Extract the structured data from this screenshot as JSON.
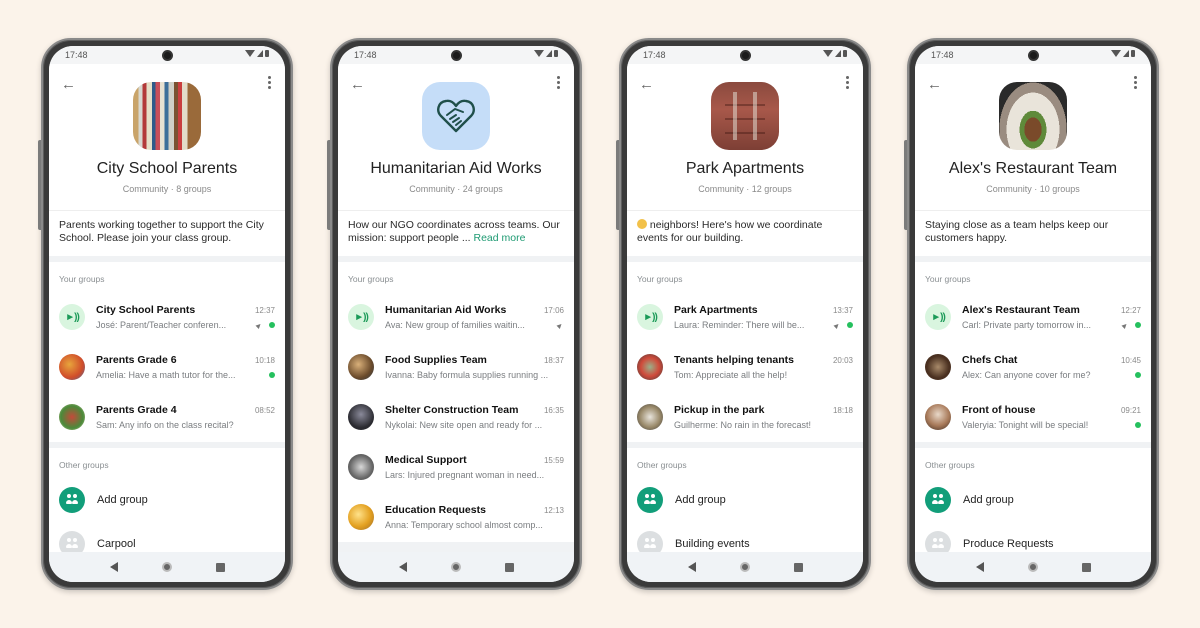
{
  "status_time": "17:48",
  "labels": {
    "your_groups": "Your groups",
    "other_groups": "Other groups",
    "add_group": "Add group"
  },
  "phones": [
    {
      "title": "City School Parents",
      "subtitle": "Community · 8 groups",
      "description": "Parents working together to support the City School. Please join your class group.",
      "read_more": "",
      "groups": [
        {
          "name": "City School Parents",
          "time": "12:37",
          "message": "José: Parent/Teacher conferen...",
          "pinned": true,
          "unread": true,
          "announcement": true
        },
        {
          "name": "Parents Grade 6",
          "time": "10:18",
          "message": "Amelia: Have a math tutor for the...",
          "pinned": false,
          "unread": true
        },
        {
          "name": "Parents Grade 4",
          "time": "08:52",
          "message": "Sam: Any info on the class recital?",
          "pinned": false,
          "unread": false
        }
      ],
      "other_groups": [
        "Carpool"
      ]
    },
    {
      "title": "Humanitarian Aid Works",
      "subtitle": "Community · 24 groups",
      "description": "How our NGO coordinates across teams. Our mission: support people ...",
      "read_more": "Read more",
      "groups": [
        {
          "name": "Humanitarian Aid Works",
          "time": "17:06",
          "message": "Ava: New group of families waitin...",
          "pinned": true,
          "unread": false,
          "announcement": true
        },
        {
          "name": "Food Supplies Team",
          "time": "18:37",
          "message": "Ivanna: Baby formula supplies running ...",
          "pinned": false,
          "unread": false
        },
        {
          "name": "Shelter Construction Team",
          "time": "16:35",
          "message": "Nykolai: New site open and ready for ...",
          "pinned": false,
          "unread": false
        },
        {
          "name": "Medical Support",
          "time": "15:59",
          "message": "Lars: Injured pregnant woman in need...",
          "pinned": false,
          "unread": false
        },
        {
          "name": "Education Requests",
          "time": "12:13",
          "message": "Anna: Temporary school almost comp...",
          "pinned": false,
          "unread": false
        }
      ],
      "other_groups": []
    },
    {
      "title": "Park Apartments",
      "subtitle": "Community · 12 groups",
      "description": "neighbors! Here's how we coordinate events for our building.",
      "read_more": "",
      "groups": [
        {
          "name": "Park Apartments",
          "time": "13:37",
          "message": "Laura: Reminder: There will be...",
          "pinned": true,
          "unread": true,
          "announcement": true
        },
        {
          "name": "Tenants helping tenants",
          "time": "20:03",
          "message": "Tom: Appreciate all the help!",
          "pinned": false,
          "unread": false
        },
        {
          "name": "Pickup in the park",
          "time": "18:18",
          "message": "Guilherme: No rain in the forecast!",
          "pinned": false,
          "unread": false
        }
      ],
      "other_groups": [
        "Building events"
      ]
    },
    {
      "title": "Alex's Restaurant Team",
      "subtitle": "Community · 10 groups",
      "description": "Staying close as a team helps keep our customers happy.",
      "read_more": "",
      "groups": [
        {
          "name": "Alex's Restaurant Team",
          "time": "12:27",
          "message": "Carl: Private party tomorrow in...",
          "pinned": true,
          "unread": true,
          "announcement": true
        },
        {
          "name": "Chefs Chat",
          "time": "10:45",
          "message": "Alex: Can anyone cover for me?",
          "pinned": false,
          "unread": true
        },
        {
          "name": "Front of house",
          "time": "09:21",
          "message": "Valeryia: Tonight will be special!",
          "pinned": false,
          "unread": true
        }
      ],
      "other_groups": [
        "Produce Requests"
      ]
    }
  ],
  "colors": {
    "background": "#fbf3ea",
    "accent_green": "#129e7a",
    "unread_dot": "#25c05e",
    "link": "#1d9a72"
  }
}
